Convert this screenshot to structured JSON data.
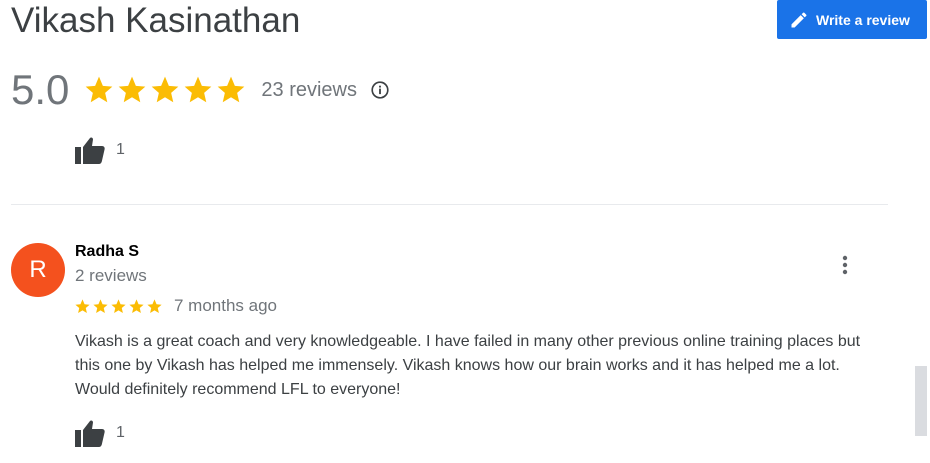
{
  "header": {
    "business_name": "Vikash Kasinathan",
    "write_review_label": "Write a review",
    "write_review_icon": "pencil-icon",
    "button_color": "#1a73e8"
  },
  "summary": {
    "rating": "5.0",
    "stars": 5,
    "review_count_text": "23 reviews",
    "info_icon": "info-icon",
    "star_color": "#fbbc04"
  },
  "previous_review": {
    "likes": "1"
  },
  "review": {
    "avatar_letter": "R",
    "avatar_color": "#f4511e",
    "author": "Radha S",
    "author_reviews": "2 reviews",
    "stars": 5,
    "date": "7 months ago",
    "text": "Vikash is a great coach and very knowledgeable. I have failed in many other previous online training places but this one by Vikash has helped me immensely. Vikash knows how our brain works and it has helped me a lot. Would definitely recommend LFL to everyone!",
    "likes": "1"
  }
}
